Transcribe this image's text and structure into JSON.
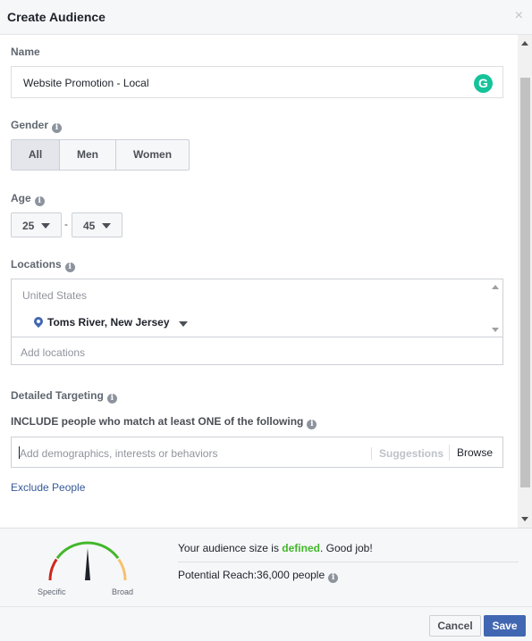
{
  "header": {
    "title": "Create Audience",
    "close_glyph": "×"
  },
  "name": {
    "label": "Name",
    "value": "Website Promotion - Local",
    "grammarly_glyph": "G"
  },
  "gender": {
    "label": "Gender",
    "info_glyph": "i",
    "options": [
      "All",
      "Men",
      "Women"
    ],
    "selected": "All"
  },
  "age": {
    "label": "Age",
    "info_glyph": "i",
    "min": "25",
    "max": "45",
    "separator": "-"
  },
  "locations": {
    "label": "Locations",
    "info_glyph": "i",
    "country": "United States",
    "city": "Toms River, New Jersey",
    "add_placeholder": "Add locations"
  },
  "detailed_targeting": {
    "label": "Detailed Targeting",
    "info_glyph": "i",
    "include_text": "INCLUDE people who match at least ONE of the following",
    "input_placeholder": "Add demographics, interests or behaviors",
    "suggestions_label": "Suggestions",
    "browse_label": "Browse",
    "exclude_link": "Exclude People"
  },
  "audience": {
    "size_prefix": "Your audience size is ",
    "size_status": "defined",
    "size_suffix": ". Good job!",
    "reach_text": "Potential Reach:36,000 people",
    "gauge_label_left": "Specific",
    "gauge_label_right": "Broad",
    "gauge_level": 0.5,
    "colors": {
      "narrow": "#d0271d",
      "good": "#42b72a",
      "broad": "#f7c16c",
      "needle": "#1d2129"
    }
  },
  "footer": {
    "cancel_label": "Cancel",
    "save_label": "Save"
  }
}
